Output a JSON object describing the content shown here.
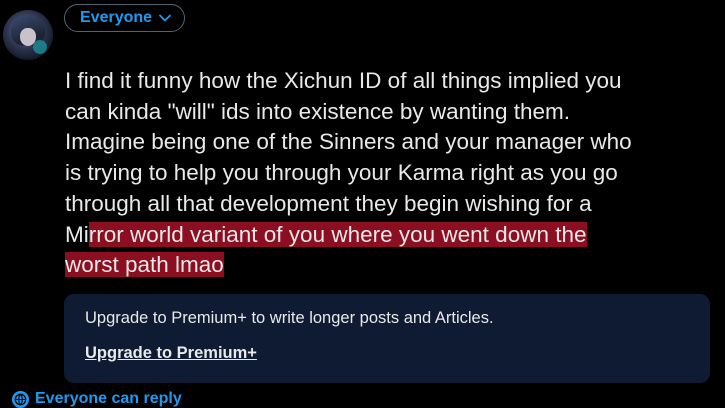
{
  "composer": {
    "audience_label": "Everyone",
    "reply_setting_label": "Everyone can reply",
    "post_lines": [
      {
        "text": "I find it funny how the Xichun ID of all things implied you"
      },
      {
        "text": "can kinda \"will\" ids into existence by wanting them."
      },
      {
        "text": "Imagine being one of the Sinners and your manager who"
      },
      {
        "text": "is trying to help you through your Karma right as you go"
      },
      {
        "text": "through all that development they begin wishing for a"
      },
      {
        "pre": "Mi",
        "highlight": "rror world variant of you where you went down the"
      },
      {
        "highlight": "worst path lmao"
      }
    ]
  },
  "upsell": {
    "message": "Upgrade to Premium+ to write longer posts and Articles.",
    "link_label": "Upgrade to Premium+"
  },
  "colors": {
    "accent": "#1d9bf0",
    "background": "#000000",
    "text": "#e7e9ea",
    "highlight": "#8b0f21",
    "upsell_bg": "#0f1a33"
  },
  "icons": {
    "audience": "chevron-down-icon",
    "reply": "globe-icon"
  }
}
